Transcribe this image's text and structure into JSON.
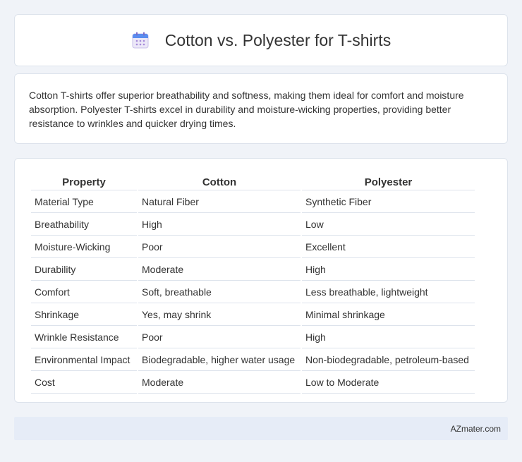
{
  "header": {
    "title": "Cotton vs. Polyester for T-shirts",
    "icon": "calendar-icon"
  },
  "summary": {
    "text": "Cotton T-shirts offer superior breathability and softness, making them ideal for comfort and moisture absorption. Polyester T-shirts excel in durability and moisture-wicking properties, providing better resistance to wrinkles and quicker drying times."
  },
  "table": {
    "headers": [
      "Property",
      "Cotton",
      "Polyester"
    ],
    "rows": [
      [
        "Material Type",
        "Natural Fiber",
        "Synthetic Fiber"
      ],
      [
        "Breathability",
        "High",
        "Low"
      ],
      [
        "Moisture-Wicking",
        "Poor",
        "Excellent"
      ],
      [
        "Durability",
        "Moderate",
        "High"
      ],
      [
        "Comfort",
        "Soft, breathable",
        "Less breathable, lightweight"
      ],
      [
        "Shrinkage",
        "Yes, may shrink",
        "Minimal shrinkage"
      ],
      [
        "Wrinkle Resistance",
        "Poor",
        "High"
      ],
      [
        "Environmental Impact",
        "Biodegradable, higher water usage",
        "Non-biodegradable, petroleum-based"
      ],
      [
        "Cost",
        "Moderate",
        "Low to Moderate"
      ]
    ]
  },
  "footer": {
    "brand": "AZmater.com"
  },
  "colors": {
    "background": "#f0f3f8",
    "card": "#ffffff",
    "border": "#dde3ec",
    "footer_bg": "#e6ecf7",
    "icon_blue": "#5b8def",
    "icon_purple": "#a78bda"
  }
}
